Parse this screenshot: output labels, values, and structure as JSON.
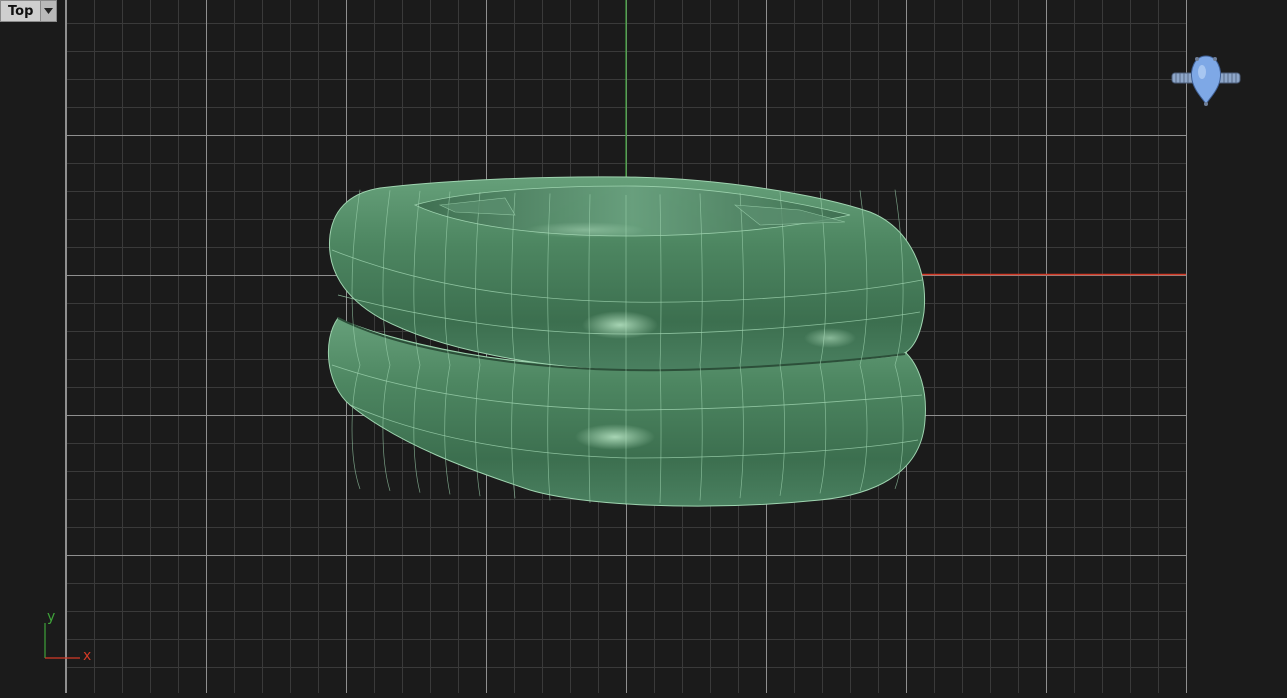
{
  "viewport": {
    "name": "Top",
    "background": "#1b1b1b",
    "grid_minor_color": "#3a3a3a",
    "grid_major_color": "#8f8f8f",
    "x_axis_color": "#d23a26",
    "y_axis_color": "#3fa33a"
  },
  "axes_indicator": {
    "x_label": "x",
    "y_label": "y"
  },
  "model": {
    "surface_color": "#4e8a63",
    "isocurve_color": "#9fd4b0"
  },
  "nav_widget": {
    "icon": "ring-gizmo-icon",
    "color": "#7ea8e6"
  }
}
